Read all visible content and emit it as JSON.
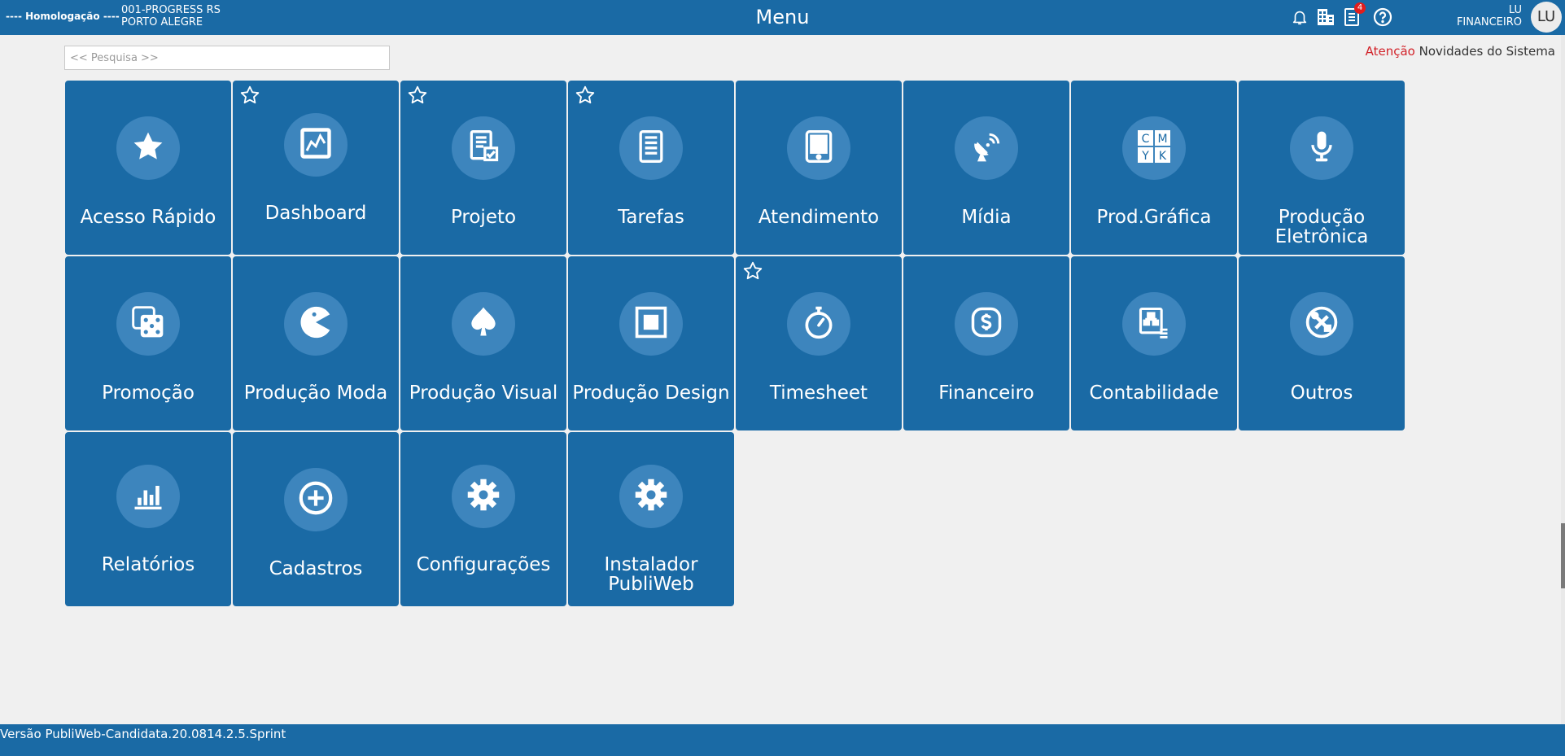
{
  "header": {
    "environment": "---- Homologação ----",
    "company_line1": "001-PROGRESS RS",
    "company_line2": "PORTO ALEGRE",
    "title": "Menu",
    "icons": [
      "bell-icon",
      "building-icon",
      "document-list-icon",
      "help-icon"
    ],
    "notification_count": "4",
    "user_name": "LU",
    "user_role": "FINANCEIRO",
    "avatar_initials": "LU"
  },
  "search": {
    "placeholder": "<< Pesquisa >>",
    "value": ""
  },
  "news": {
    "warning": "Atenção",
    "text": "Novidades do Sistema"
  },
  "tiles": [
    {
      "label": "Acesso Rápido",
      "icon": "star-icon",
      "favorite": false
    },
    {
      "label": "Dashboard",
      "icon": "line-chart-icon",
      "favorite": true
    },
    {
      "label": "Projeto",
      "icon": "document-check-icon",
      "favorite": true
    },
    {
      "label": "Tarefas",
      "icon": "task-list-icon",
      "favorite": true
    },
    {
      "label": "Atendimento",
      "icon": "tablet-icon",
      "favorite": false
    },
    {
      "label": "Mídia",
      "icon": "satellite-dish-icon",
      "favorite": false
    },
    {
      "label": "Prod.Gráfica",
      "icon": "cmyk-icon",
      "favorite": false
    },
    {
      "label": "Produção Eletrônica",
      "icon": "microphone-icon",
      "favorite": false
    },
    {
      "label": "Promoção",
      "icon": "dice-icon",
      "favorite": false
    },
    {
      "label": "Produção Moda",
      "icon": "pacman-icon",
      "favorite": false
    },
    {
      "label": "Produção Visual",
      "icon": "spade-icon",
      "favorite": false
    },
    {
      "label": "Produção Design",
      "icon": "square-frame-icon",
      "favorite": false
    },
    {
      "label": "Timesheet",
      "icon": "stopwatch-icon",
      "favorite": true
    },
    {
      "label": "Financeiro",
      "icon": "dollar-icon",
      "favorite": false
    },
    {
      "label": "Contabilidade",
      "icon": "accounting-icon",
      "favorite": false
    },
    {
      "label": "Outros",
      "icon": "tools-icon",
      "favorite": false
    },
    {
      "label": "Relatórios",
      "icon": "bar-chart-icon",
      "favorite": false
    },
    {
      "label": "Cadastros",
      "icon": "plus-circle-icon",
      "favorite": false
    },
    {
      "label": "Configurações",
      "icon": "gear-icon",
      "favorite": false
    },
    {
      "label": "Instalador PubliWeb",
      "icon": "gear-icon",
      "favorite": false
    }
  ],
  "cmyk_letters": [
    "C",
    "M",
    "Y",
    "K"
  ],
  "footer": {
    "version": "Versão PubliWeb-Candidata.20.0814.2.5.Sprint"
  },
  "colors": {
    "primary": "#1a6aa5",
    "icon_circle": "#3d85bd",
    "background": "#f0f0f0",
    "warning": "#d2232a",
    "badge": "#e11d1d"
  }
}
